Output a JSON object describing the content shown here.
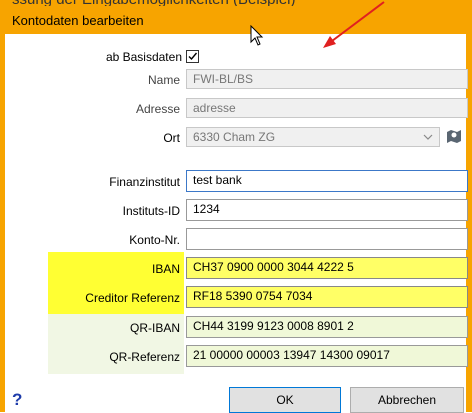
{
  "window": {
    "top_text": "ssung der Eingabemöglichkeiten (Beispiel)",
    "title": "Kontodaten bearbeiten"
  },
  "form": {
    "ab_basisdaten": {
      "label": "ab Basisdaten",
      "checked": true
    },
    "name": {
      "label": "Name",
      "value": "FWI-BL/BS"
    },
    "adresse": {
      "label": "Adresse",
      "value": "adresse"
    },
    "ort": {
      "label": "Ort",
      "value": "6330 Cham ZG"
    },
    "finanzinstitut": {
      "label": "Finanzinstitut",
      "value": "test bank"
    },
    "instituts_id": {
      "label": "Instituts-ID",
      "value": "1234"
    },
    "konto_nr": {
      "label": "Konto-Nr.",
      "value": ""
    },
    "iban": {
      "label": "IBAN",
      "value": "CH37 0900 0000 3044 4222 5"
    },
    "creditor_ref": {
      "label": "Creditor Referenz",
      "value": "RF18 5390 0754 7034"
    },
    "qr_iban": {
      "label": "QR-IBAN",
      "value": "CH44 3199 9123 0008 8901 2"
    },
    "qr_referenz": {
      "label": "QR-Referenz",
      "value": "21 00000 00003 13947 14300 09017"
    }
  },
  "buttons": {
    "ok": "OK",
    "cancel": "Abbrechen",
    "help": "?"
  },
  "colors": {
    "titlebar": "#f7a400",
    "iban_highlight": "#ffff33",
    "qr_highlight": "#f1f7e4",
    "arrow": "#e02020",
    "help": "#1e3caa"
  },
  "icons": [
    "checkmark-icon",
    "chevron-down-icon",
    "location-icon",
    "cursor-icon",
    "annotation-arrow-icon"
  ]
}
